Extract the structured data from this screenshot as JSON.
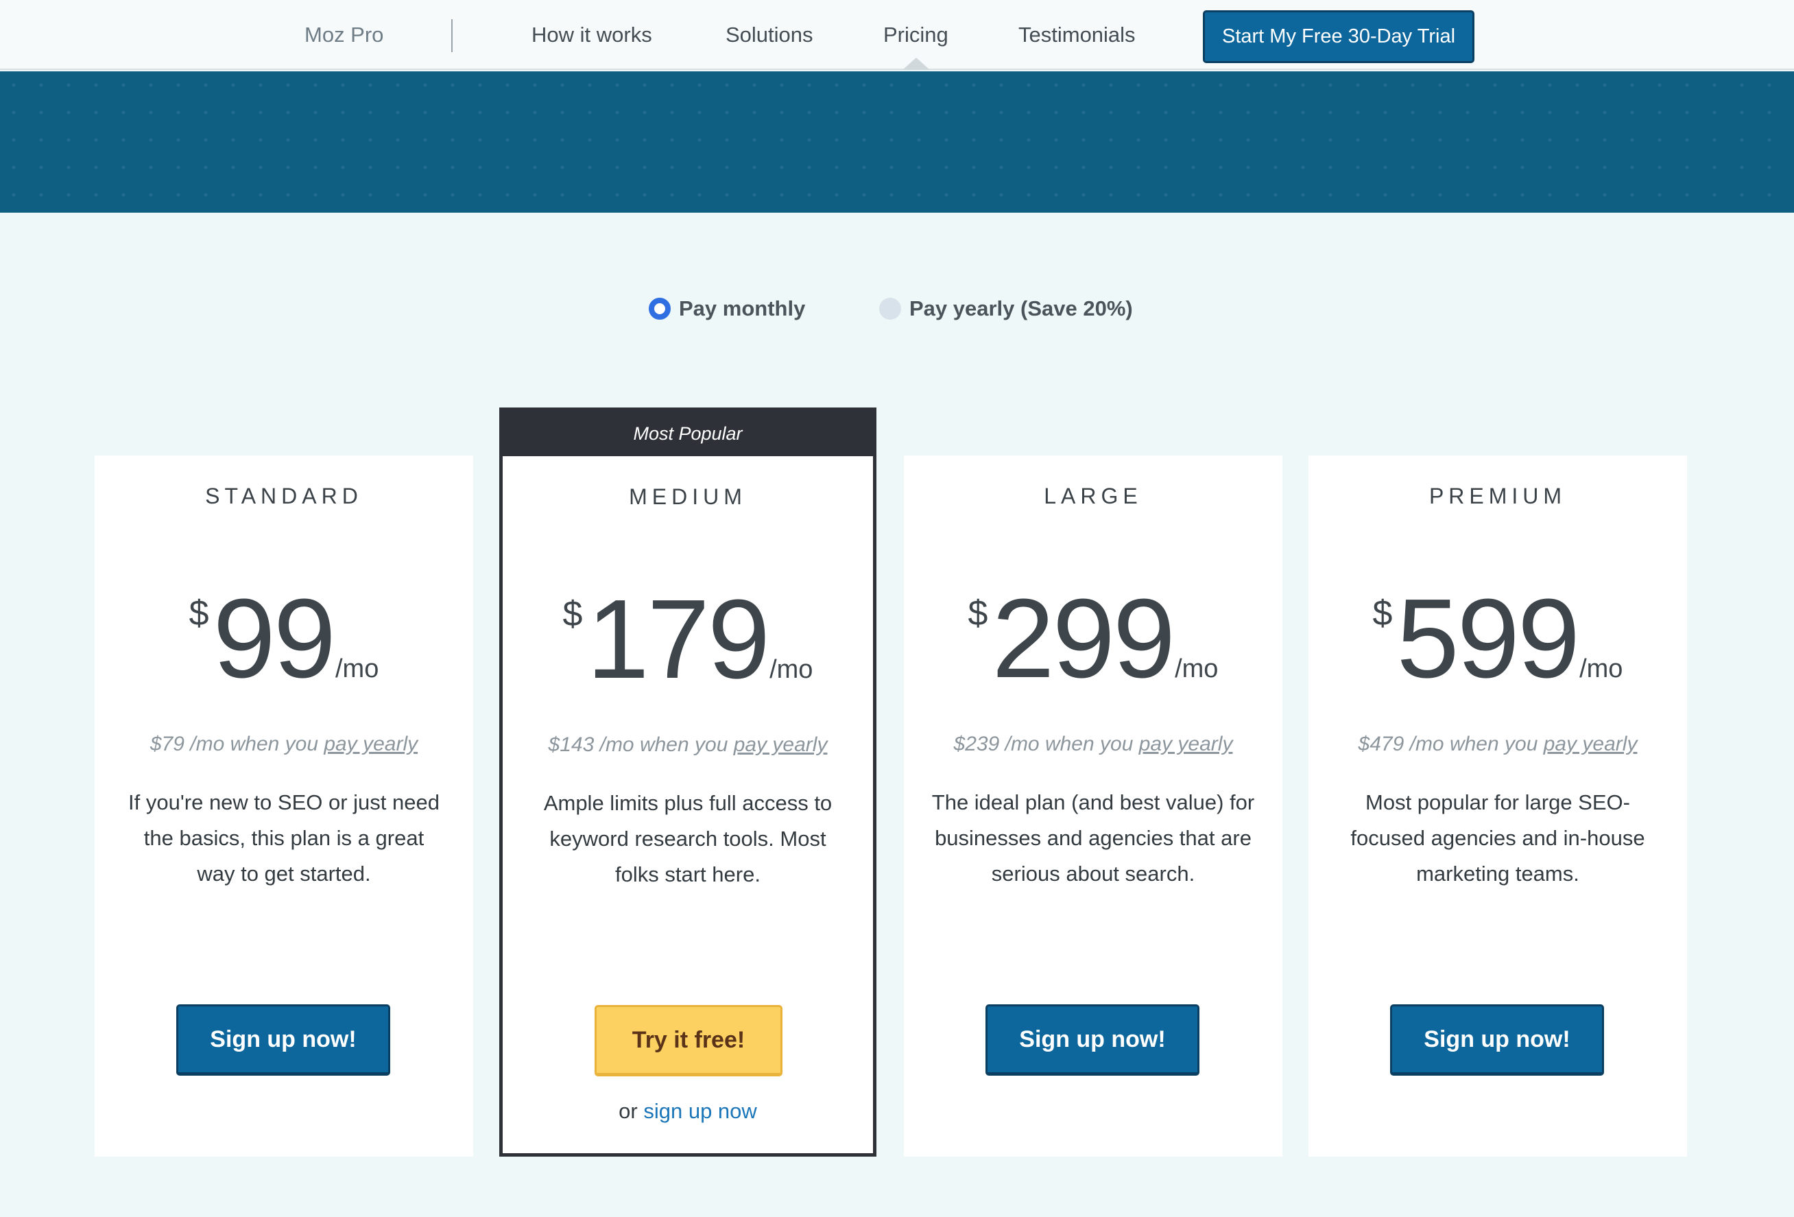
{
  "nav": {
    "brand": "Moz Pro",
    "links": [
      "How it works",
      "Solutions",
      "Pricing",
      "Testimonials"
    ],
    "active": "Pricing",
    "cta": "Start My Free 30-Day Trial"
  },
  "billing": {
    "monthly_label": "Pay monthly",
    "yearly_label": "Pay yearly (Save 20%)",
    "selected": "monthly"
  },
  "plans": [
    {
      "name": "STANDARD",
      "currency": "$",
      "price": "99",
      "period": "/mo",
      "yearly_price": "$79 /mo when you ",
      "yearly_link": "pay yearly",
      "description": "If you're new to SEO or just need the basics, this plan is a great way to get started.",
      "button": "Sign up now!"
    },
    {
      "badge": "Most Popular",
      "name": "MEDIUM",
      "currency": "$",
      "price": "179",
      "period": "/mo",
      "yearly_price": "$143 /mo when you ",
      "yearly_link": "pay yearly",
      "description": "Ample limits plus full access to keyword research tools. Most folks start here.",
      "button": "Try it free!",
      "alt_prefix": "or ",
      "alt_link": "sign up now"
    },
    {
      "name": "LARGE",
      "currency": "$",
      "price": "299",
      "period": "/mo",
      "yearly_price": "$239 /mo when you ",
      "yearly_link": "pay yearly",
      "description": "The ideal plan (and best value) for businesses and agencies that are serious about search.",
      "button": "Sign up now!"
    },
    {
      "name": "PREMIUM",
      "currency": "$",
      "price": "599",
      "period": "/mo",
      "yearly_price": "$479 /mo when you ",
      "yearly_link": "pay yearly",
      "description": "Most popular for large SEO-focused agencies and in-house marketing teams.",
      "button": "Sign up now!"
    }
  ],
  "colors": {
    "primary_button": "#0e679c",
    "highlight_button": "#fdd161",
    "hero": "#0f5f83",
    "featured_border": "#2e3238",
    "radio_selected": "#2f6fe2"
  }
}
